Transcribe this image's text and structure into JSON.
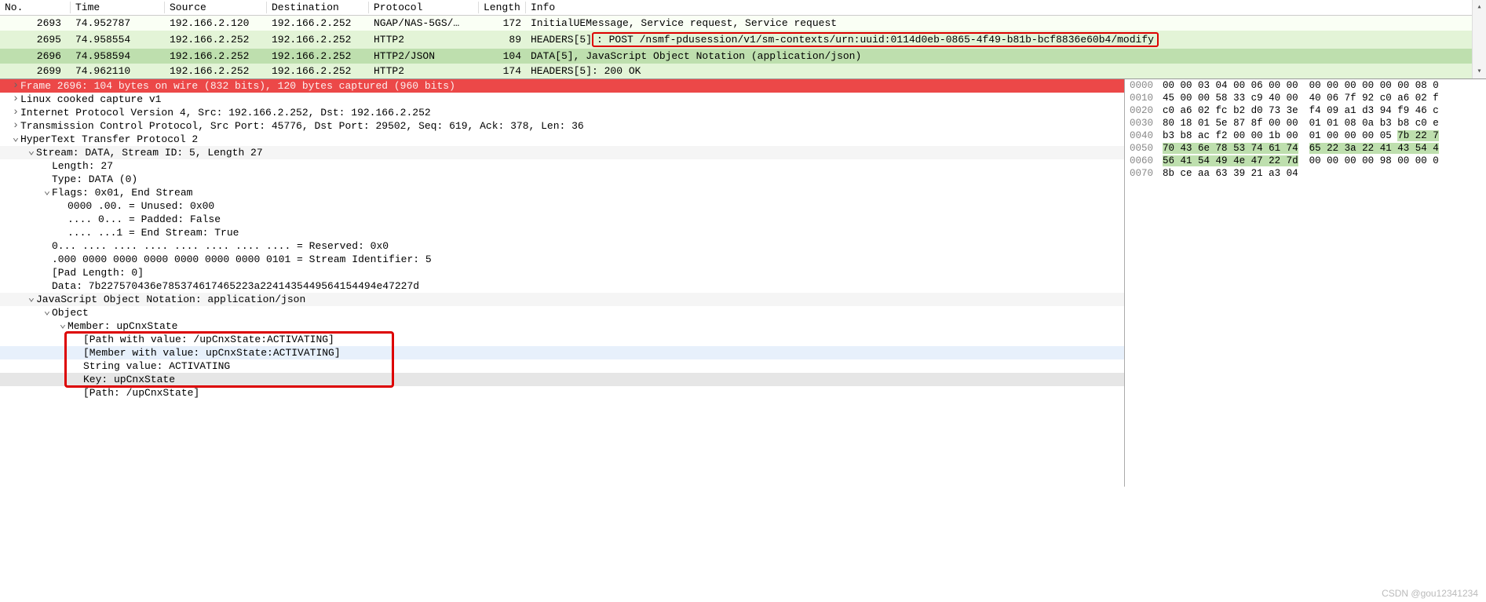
{
  "columns": {
    "no": "No.",
    "time": "Time",
    "src": "Source",
    "dst": "Destination",
    "proto": "Protocol",
    "len": "Length",
    "info": "Info"
  },
  "packets": [
    {
      "no": "2693",
      "time": "74.952787",
      "src": "192.166.2.120",
      "dst": "192.166.2.252",
      "proto": "NGAP/NAS-5GS/…",
      "len": "172",
      "info": "InitialUEMessage, Service request, Service request",
      "rowcls": "row-plain"
    },
    {
      "no": "2695",
      "time": "74.958554",
      "src": "192.166.2.252",
      "dst": "192.166.2.252",
      "proto": "HTTP2",
      "len": "89",
      "info_pre": "HEADERS[5]",
      "info_hl": ": POST /nsmf-pdusession/v1/sm-contexts/urn:uuid:0114d0eb-0865-4f49-b81b-bcf8836e60b4/modify",
      "rowcls": "row-green"
    },
    {
      "no": "2696",
      "time": "74.958594",
      "src": "192.166.2.252",
      "dst": "192.166.2.252",
      "proto": "HTTP2/JSON",
      "len": "104",
      "info": "DATA[5], JavaScript Object Notation (application/json)",
      "rowcls": "row-selected"
    },
    {
      "no": "2699",
      "time": "74.962110",
      "src": "192.166.2.252",
      "dst": "192.166.2.252",
      "proto": "HTTP2",
      "len": "174",
      "info": "HEADERS[5]: 200 OK",
      "rowcls": "row-green"
    }
  ],
  "tree": [
    {
      "id": "frame",
      "arrow": "right",
      "indent": 1,
      "cls": "row-red",
      "text": "Frame 2696: 104 bytes on wire (832 bits), 120 bytes captured (960 bits)"
    },
    {
      "id": "sll",
      "arrow": "right",
      "indent": 1,
      "cls": "",
      "text": "Linux cooked capture v1"
    },
    {
      "id": "ip",
      "arrow": "right",
      "indent": 1,
      "cls": "",
      "text": "Internet Protocol Version 4, Src: 192.166.2.252, Dst: 192.166.2.252"
    },
    {
      "id": "tcp",
      "arrow": "right",
      "indent": 1,
      "cls": "",
      "text": "Transmission Control Protocol, Src Port: 45776, Dst Port: 29502, Seq: 619, Ack: 378, Len: 36"
    },
    {
      "id": "http2",
      "arrow": "down",
      "indent": 1,
      "cls": "",
      "text": "HyperText Transfer Protocol 2"
    },
    {
      "id": "stream",
      "arrow": "down",
      "indent": 2,
      "cls": "row-lgray",
      "text": "Stream: DATA, Stream ID: 5, Length 27"
    },
    {
      "id": "len",
      "arrow": "none",
      "indent": 3,
      "cls": "",
      "text": "Length: 27"
    },
    {
      "id": "type",
      "arrow": "none",
      "indent": 3,
      "cls": "",
      "text": "Type: DATA (0)"
    },
    {
      "id": "flags",
      "arrow": "down",
      "indent": 3,
      "cls": "",
      "text": "Flags: 0x01, End Stream"
    },
    {
      "id": "f-unused",
      "arrow": "none",
      "indent": 4,
      "cls": "",
      "text": "0000 .00. = Unused: 0x00"
    },
    {
      "id": "f-padded",
      "arrow": "none",
      "indent": 4,
      "cls": "",
      "text": ".... 0... = Padded: False"
    },
    {
      "id": "f-end",
      "arrow": "none",
      "indent": 4,
      "cls": "",
      "text": ".... ...1 = End Stream: True"
    },
    {
      "id": "reserved",
      "arrow": "none",
      "indent": 3,
      "cls": "",
      "text": "0... .... .... .... .... .... .... .... = Reserved: 0x0"
    },
    {
      "id": "sid",
      "arrow": "none",
      "indent": 3,
      "cls": "",
      "text": ".000 0000 0000 0000 0000 0000 0000 0101 = Stream Identifier: 5"
    },
    {
      "id": "padlen",
      "arrow": "none",
      "indent": 3,
      "cls": "",
      "text": "[Pad Length: 0]"
    },
    {
      "id": "data",
      "arrow": "none",
      "indent": 3,
      "cls": "",
      "text": "Data: 7b227570436e785374617465223a2241435449564154494e47227d"
    },
    {
      "id": "json",
      "arrow": "down",
      "indent": 2,
      "cls": "row-lgray",
      "text": "JavaScript Object Notation: application/json"
    },
    {
      "id": "obj",
      "arrow": "down",
      "indent": 3,
      "cls": "",
      "text": "Object"
    },
    {
      "id": "member",
      "arrow": "down",
      "indent": 4,
      "cls": "",
      "text": "Member: upCnxState"
    },
    {
      "id": "pathv",
      "arrow": "none",
      "indent": 5,
      "cls": "",
      "text": "[Path with value: /upCnxState:ACTIVATING]"
    },
    {
      "id": "memberv",
      "arrow": "none",
      "indent": 5,
      "cls": "row-sel",
      "text": "[Member with value: upCnxState:ACTIVATING]"
    },
    {
      "id": "strv",
      "arrow": "none",
      "indent": 5,
      "cls": "",
      "text": "String value: ACTIVATING"
    },
    {
      "id": "key",
      "arrow": "none",
      "indent": 5,
      "cls": "row-gray",
      "text": "Key: upCnxState"
    },
    {
      "id": "path",
      "arrow": "none",
      "indent": 5,
      "cls": "",
      "text": "[Path: /upCnxState]"
    }
  ],
  "hex": [
    {
      "off": "0000",
      "l": "00 00 03 04 00 06 00 00",
      "r": "00 00 00 00 00 00 08 0"
    },
    {
      "off": "0010",
      "l": "45 00 00 58 33 c9 40 00",
      "r": "40 06 7f 92 c0 a6 02 f"
    },
    {
      "off": "0020",
      "l": "c0 a6 02 fc b2 d0 73 3e",
      "r": "f4 09 a1 d3 94 f9 46 c"
    },
    {
      "off": "0030",
      "l": "80 18 01 5e 87 8f 00 00",
      "r": "01 01 08 0a b3 b8 c0 e"
    },
    {
      "off": "0040",
      "l": "b3 b8 ac f2 00 00 1b 00",
      "r": "01 00 00 00 05 7b 22 7",
      "r_hl_from": 5
    },
    {
      "off": "0050",
      "l": "70 43 6e 78 53 74 61 74",
      "r": "65 22 3a 22 41 43 54 4",
      "l_hl": true,
      "r_hl": true
    },
    {
      "off": "0060",
      "l": "56 41 54 49 4e 47 22 7d",
      "r": "00 00 00 00 98 00 00 0",
      "l_hl": true
    },
    {
      "off": "0070",
      "l": "8b ce aa 63 39 21 a3 04",
      "r": ""
    }
  ],
  "watermark": "CSDN @gou12341234"
}
